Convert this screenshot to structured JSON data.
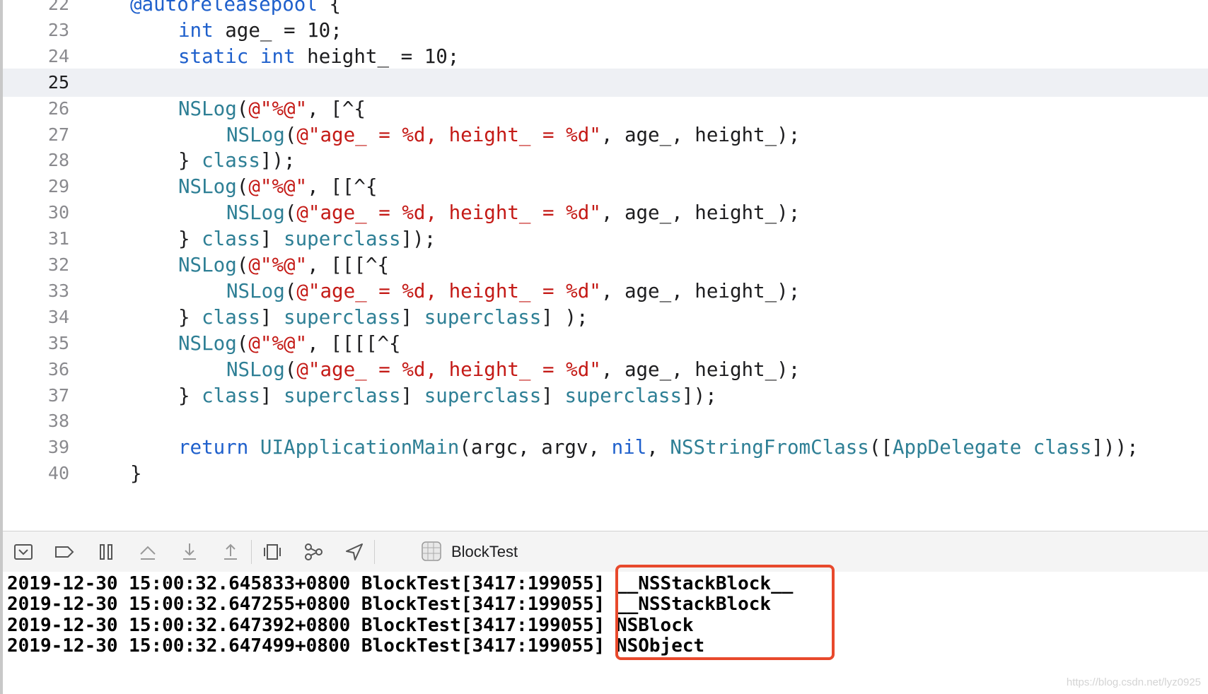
{
  "editor": {
    "current_line": "25",
    "lines": [
      {
        "n": "22",
        "tokens": [
          {
            "t": "@autoreleasepool",
            "c": "kw"
          },
          {
            "t": " {",
            "c": ""
          }
        ]
      },
      {
        "n": "23",
        "tokens": [
          {
            "t": "int",
            "c": "kw"
          },
          {
            "t": " age_ = 10;",
            "c": ""
          }
        ]
      },
      {
        "n": "24",
        "tokens": [
          {
            "t": "static",
            "c": "kw"
          },
          {
            "t": " ",
            "c": ""
          },
          {
            "t": "int",
            "c": "kw"
          },
          {
            "t": " height_ = 10;",
            "c": ""
          }
        ]
      },
      {
        "n": "25",
        "tokens": []
      },
      {
        "n": "26",
        "tokens": [
          {
            "t": "NSLog",
            "c": "fn"
          },
          {
            "t": "(",
            "c": ""
          },
          {
            "t": "@\"%@\"",
            "c": "str"
          },
          {
            "t": ", [^{",
            "c": ""
          }
        ]
      },
      {
        "n": "27",
        "tokens": [
          {
            "t": "NSLog",
            "c": "fn"
          },
          {
            "t": "(",
            "c": ""
          },
          {
            "t": "@\"age_ = %d, height_ = %d\"",
            "c": "str"
          },
          {
            "t": ", age_, height_);",
            "c": ""
          }
        ]
      },
      {
        "n": "28",
        "tokens": [
          {
            "t": "} ",
            "c": ""
          },
          {
            "t": "class",
            "c": "fn"
          },
          {
            "t": "]);",
            "c": ""
          }
        ]
      },
      {
        "n": "29",
        "tokens": [
          {
            "t": "NSLog",
            "c": "fn"
          },
          {
            "t": "(",
            "c": ""
          },
          {
            "t": "@\"%@\"",
            "c": "str"
          },
          {
            "t": ", [[^{",
            "c": ""
          }
        ]
      },
      {
        "n": "30",
        "tokens": [
          {
            "t": "NSLog",
            "c": "fn"
          },
          {
            "t": "(",
            "c": ""
          },
          {
            "t": "@\"age_ = %d, height_ = %d\"",
            "c": "str"
          },
          {
            "t": ", age_, height_);",
            "c": ""
          }
        ]
      },
      {
        "n": "31",
        "tokens": [
          {
            "t": "} ",
            "c": ""
          },
          {
            "t": "class",
            "c": "fn"
          },
          {
            "t": "] ",
            "c": ""
          },
          {
            "t": "superclass",
            "c": "fn"
          },
          {
            "t": "]);",
            "c": ""
          }
        ]
      },
      {
        "n": "32",
        "tokens": [
          {
            "t": "NSLog",
            "c": "fn"
          },
          {
            "t": "(",
            "c": ""
          },
          {
            "t": "@\"%@\"",
            "c": "str"
          },
          {
            "t": ", [[[^{",
            "c": ""
          }
        ]
      },
      {
        "n": "33",
        "tokens": [
          {
            "t": "NSLog",
            "c": "fn"
          },
          {
            "t": "(",
            "c": ""
          },
          {
            "t": "@\"age_ = %d, height_ = %d\"",
            "c": "str"
          },
          {
            "t": ", age_, height_);",
            "c": ""
          }
        ]
      },
      {
        "n": "34",
        "tokens": [
          {
            "t": "} ",
            "c": ""
          },
          {
            "t": "class",
            "c": "fn"
          },
          {
            "t": "] ",
            "c": ""
          },
          {
            "t": "superclass",
            "c": "fn"
          },
          {
            "t": "] ",
            "c": ""
          },
          {
            "t": "superclass",
            "c": "fn"
          },
          {
            "t": "] );",
            "c": ""
          }
        ]
      },
      {
        "n": "35",
        "tokens": [
          {
            "t": "NSLog",
            "c": "fn"
          },
          {
            "t": "(",
            "c": ""
          },
          {
            "t": "@\"%@\"",
            "c": "str"
          },
          {
            "t": ", [[[[^{",
            "c": ""
          }
        ]
      },
      {
        "n": "36",
        "tokens": [
          {
            "t": "NSLog",
            "c": "fn"
          },
          {
            "t": "(",
            "c": ""
          },
          {
            "t": "@\"age_ = %d, height_ = %d\"",
            "c": "str"
          },
          {
            "t": ", age_, height_);",
            "c": ""
          }
        ]
      },
      {
        "n": "37",
        "tokens": [
          {
            "t": "} ",
            "c": ""
          },
          {
            "t": "class",
            "c": "fn"
          },
          {
            "t": "] ",
            "c": ""
          },
          {
            "t": "superclass",
            "c": "fn"
          },
          {
            "t": "] ",
            "c": ""
          },
          {
            "t": "superclass",
            "c": "fn"
          },
          {
            "t": "] ",
            "c": ""
          },
          {
            "t": "superclass",
            "c": "fn"
          },
          {
            "t": "]);",
            "c": ""
          }
        ]
      },
      {
        "n": "38",
        "tokens": []
      },
      {
        "n": "39",
        "tokens": [
          {
            "t": "return",
            "c": "kw"
          },
          {
            "t": " ",
            "c": ""
          },
          {
            "t": "UIApplicationMain",
            "c": "fn"
          },
          {
            "t": "(argc, argv, ",
            "c": ""
          },
          {
            "t": "nil",
            "c": "kw"
          },
          {
            "t": ", ",
            "c": ""
          },
          {
            "t": "NSStringFromClass",
            "c": "fn"
          },
          {
            "t": "([",
            "c": ""
          },
          {
            "t": "AppDelegate",
            "c": "fn"
          },
          {
            "t": " ",
            "c": ""
          },
          {
            "t": "class",
            "c": "fn"
          },
          {
            "t": "]));",
            "c": ""
          }
        ]
      },
      {
        "n": "40",
        "tokens": [
          {
            "t": "}",
            "c": ""
          }
        ]
      }
    ]
  },
  "debug_bar": {
    "buttons": [
      {
        "name": "hide-debug-area-icon"
      },
      {
        "name": "breakpoints-toggle-icon"
      },
      {
        "name": "pause-icon"
      },
      {
        "name": "step-over-icon"
      },
      {
        "name": "step-into-icon"
      },
      {
        "name": "step-out-icon"
      },
      {
        "name": "view-hierarchy-icon"
      },
      {
        "name": "memory-graph-icon"
      },
      {
        "name": "simulate-location-icon"
      }
    ],
    "target_name": "BlockTest"
  },
  "console": {
    "lines": [
      {
        "prefix": "2019-12-30 15:00:32.645833+0800 BlockTest[3417:199055]",
        "value": "__NSStackBlock__"
      },
      {
        "prefix": "2019-12-30 15:00:32.647255+0800 BlockTest[3417:199055]",
        "value": "__NSStackBlock"
      },
      {
        "prefix": "2019-12-30 15:00:32.647392+0800 BlockTest[3417:199055]",
        "value": "NSBlock"
      },
      {
        "prefix": "2019-12-30 15:00:32.647499+0800 BlockTest[3417:199055]",
        "value": "NSObject"
      }
    ],
    "highlight_color": "#e8492c"
  },
  "watermark": "https://blog.csdn.net/lyz0925",
  "colors": {
    "keyword": "#1f60cc",
    "function": "#2e7f95",
    "string": "#c41a16",
    "text": "#1d1d1f"
  }
}
